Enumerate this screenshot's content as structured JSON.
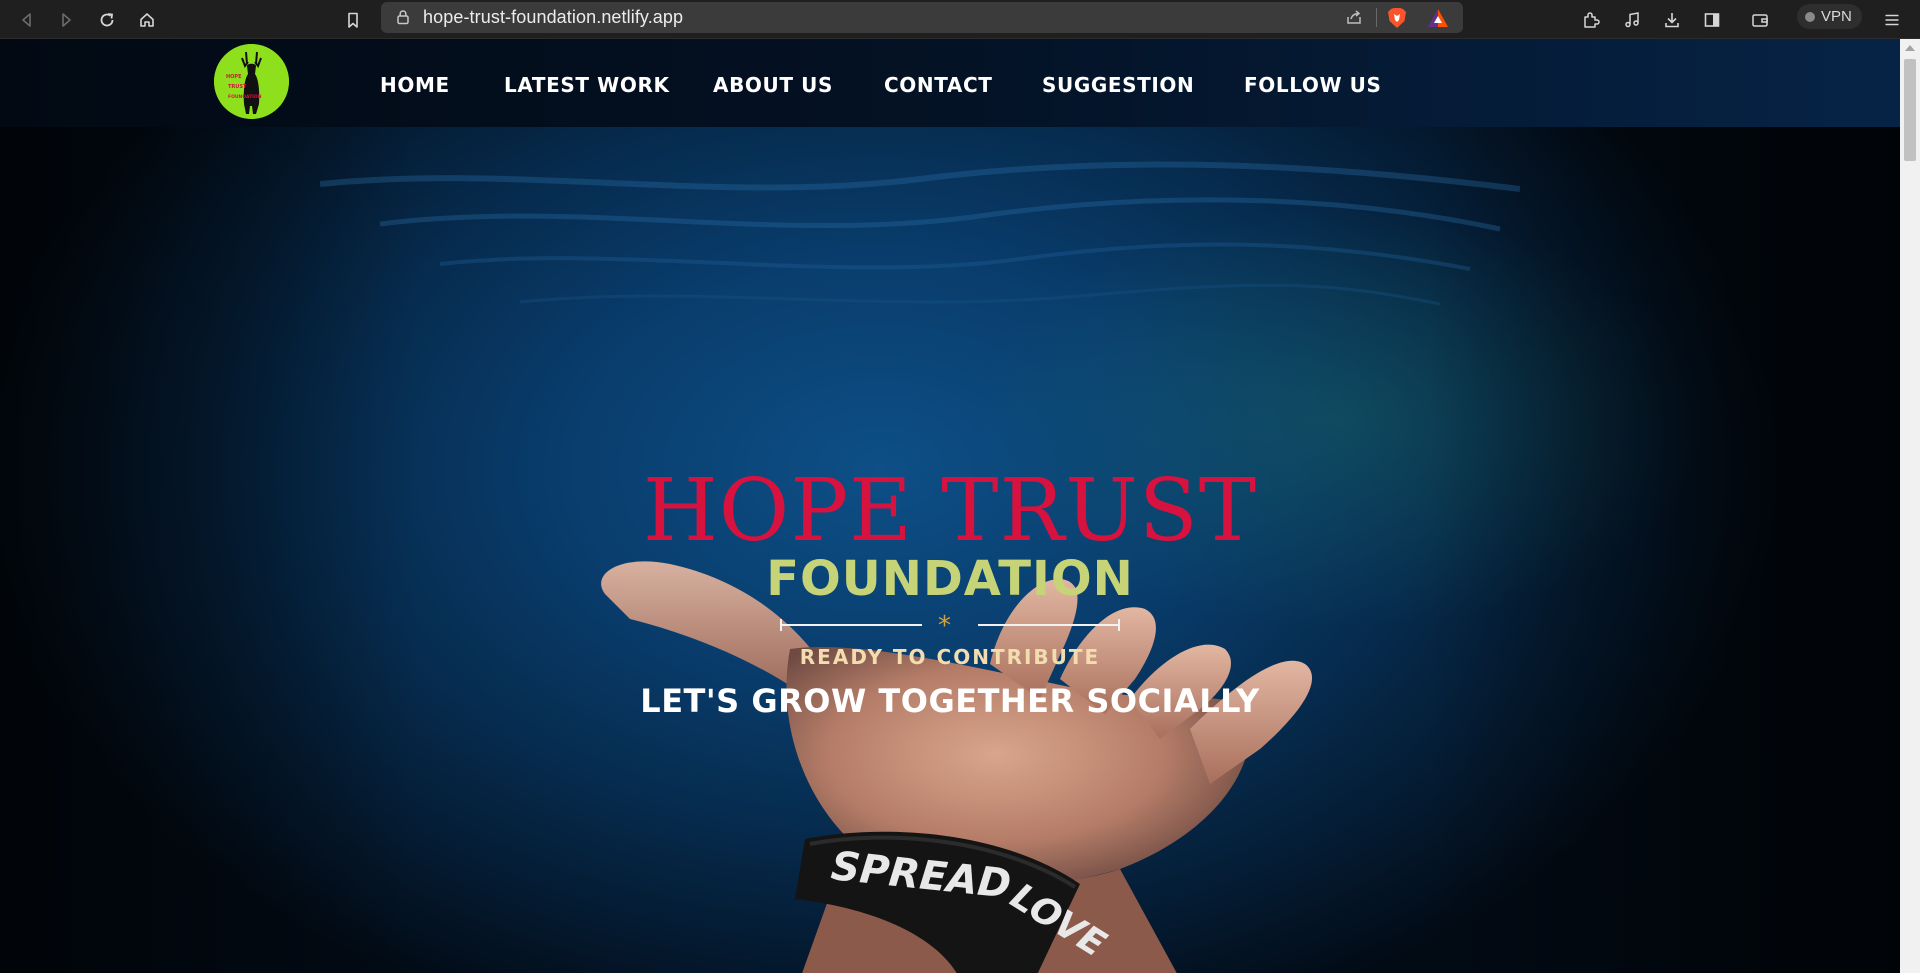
{
  "browser": {
    "url": "hope-trust-foundation.netlify.app",
    "vpn_label": "VPN"
  },
  "navbar": {
    "logo_text": "HOPE TRUST FOUNDATION",
    "links": [
      "HOME",
      "LATEST WORK",
      "ABOUT US",
      "CONTACT",
      "SUGGESTION",
      "FOLLOW US"
    ]
  },
  "hero": {
    "title": "HOPE TRUST",
    "subtitle": "FOUNDATION",
    "divider_symbol": "*",
    "tagline": "READY TO CONTRIBUTE",
    "slogan": "LET'S GROW TOGETHER SOCIALLY",
    "wristband_text": "SPREAD LOVE"
  },
  "colors": {
    "title_red": "#d8123f",
    "subtitle_green": "#c6d477",
    "tagline_cream": "#f3dcae",
    "accent_gold": "#d4a13a",
    "logo_green": "#8ee01c"
  }
}
